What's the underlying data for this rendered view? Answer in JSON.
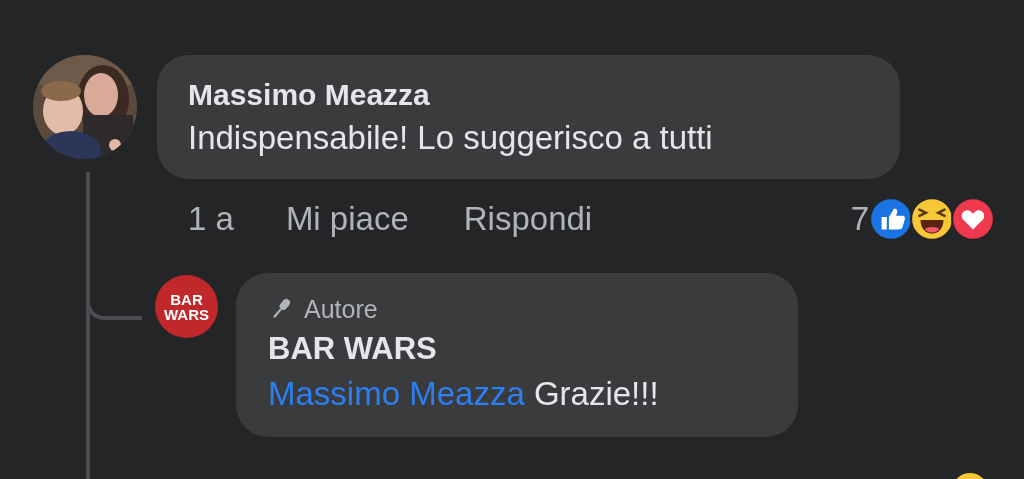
{
  "comment": {
    "author": "Massimo Meazza",
    "text": "Indispensabile! Lo suggerisco a tutti",
    "time": "1 a",
    "actions": [
      "Mi piace",
      "Rispondi"
    ],
    "reaction_count": "7"
  },
  "reply": {
    "logo_lines": [
      "BAR",
      "WARS"
    ],
    "badge": "Autore",
    "author": "BAR WARS",
    "mention": "Massimo Meazza",
    "text": "Grazie!!!"
  }
}
